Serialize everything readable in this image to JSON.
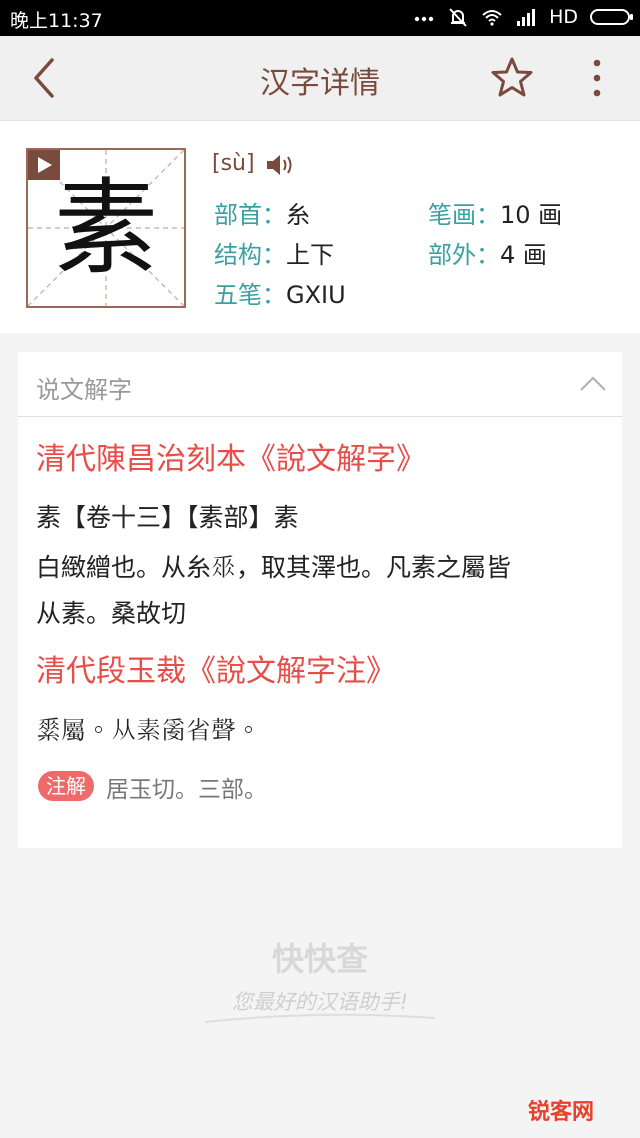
{
  "status_bar": {
    "time": "晚上11:37",
    "signal_label": "HD"
  },
  "nav": {
    "title": "汉字详情",
    "back_icon": "chevron-left-icon",
    "star_icon": "star-outline-icon",
    "more_icon": "more-vertical-icon"
  },
  "character": {
    "glyph": "素",
    "pinyin": "[sù]",
    "radical_label": "部首：",
    "radical_value": "糸",
    "strokes_label": "笔画：",
    "strokes_value": "10 画",
    "structure_label": "结构：",
    "structure_value": "上下",
    "extra_strokes_label": "部外：",
    "extra_strokes_value": "4 画",
    "wubi_label": "五笔：",
    "wubi_value": "GXIU"
  },
  "panel": {
    "title": "说文解字",
    "source1": "清代陳昌治刻本《說文解字》",
    "line1": "素【卷十三】【素部】素",
    "line2": "白緻繒也。从糸𠂹，取其澤也。凡素之屬皆",
    "line3": "从素。桑故切",
    "source2": "清代段玉裁《說文解字注》",
    "line4": "𦃃屬。从素𤔔省聲。",
    "note_badge": "注解",
    "note_text": "居玉切。三部。"
  },
  "footer": {
    "logo": "快快查",
    "slogan": "您最好的汉语助手!",
    "corner_mark": "锐客网"
  },
  "colors": {
    "brand_brown": "#7a4a3c",
    "teal": "#3aa0a3",
    "red": "#e84d4a",
    "badge_red": "#ef6b6b"
  }
}
